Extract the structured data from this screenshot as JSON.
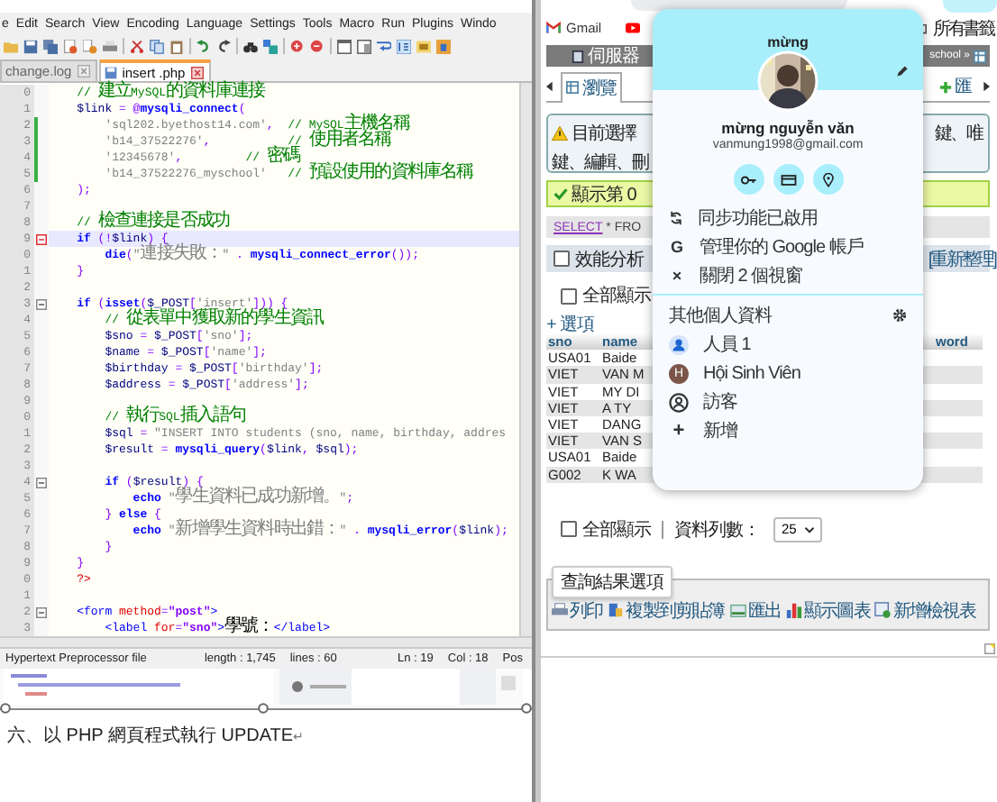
{
  "editor": {
    "menu": [
      "e",
      "Edit",
      "Search",
      "View",
      "Encoding",
      "Language",
      "Settings",
      "Tools",
      "Macro",
      "Run",
      "Plugins",
      "Windo"
    ],
    "tabs": [
      {
        "label": "change.log",
        "selected": false
      },
      {
        "label": "insert .php",
        "selected": true
      }
    ],
    "lines": [
      {
        "num": "0",
        "fold": false,
        "changed": false,
        "current": false,
        "tokens": [
          {
            "kind": "comment",
            "text": "    // "
          },
          {
            "kind": "comment-cjk",
            "text": "建立"
          },
          {
            "kind": "comment",
            "text": "MySQL"
          },
          {
            "kind": "comment-cjk",
            "text": "的資料庫連接"
          }
        ]
      },
      {
        "num": "1",
        "fold": false,
        "changed": false,
        "current": false,
        "tokens": [
          {
            "kind": "var",
            "text": "    $link"
          },
          {
            "kind": "op",
            "text": " = @"
          },
          {
            "kind": "fn",
            "text": "mysqli_connect"
          },
          {
            "kind": "op",
            "text": "("
          }
        ]
      },
      {
        "num": "2",
        "fold": false,
        "changed": true,
        "current": false,
        "tokens": [
          {
            "kind": "string",
            "text": "        'sql202.byethost14.com'"
          },
          {
            "kind": "op",
            "text": ",  "
          },
          {
            "kind": "comment",
            "text": "// MySQL"
          },
          {
            "kind": "comment-cjk",
            "text": "主機名稱"
          }
        ]
      },
      {
        "num": "3",
        "fold": false,
        "changed": true,
        "current": false,
        "tokens": [
          {
            "kind": "string",
            "text": "        'b14_37522276'"
          },
          {
            "kind": "op",
            "text": ",           "
          },
          {
            "kind": "comment",
            "text": "// "
          },
          {
            "kind": "comment-cjk",
            "text": "使用者名稱"
          }
        ]
      },
      {
        "num": "4",
        "fold": false,
        "changed": true,
        "current": false,
        "tokens": [
          {
            "kind": "string",
            "text": "        '12345678'"
          },
          {
            "kind": "op",
            "text": ",         "
          },
          {
            "kind": "comment",
            "text": "// "
          },
          {
            "kind": "comment-cjk",
            "text": "密碼"
          }
        ]
      },
      {
        "num": "5",
        "fold": false,
        "changed": true,
        "current": false,
        "tokens": [
          {
            "kind": "string",
            "text": "        'b14_37522276_myschool'"
          },
          {
            "kind": "comment",
            "text": "   // "
          },
          {
            "kind": "comment-cjk",
            "text": "預設使用的資料庫名稱"
          }
        ]
      },
      {
        "num": "6",
        "fold": false,
        "changed": false,
        "current": false,
        "tokens": [
          {
            "kind": "op",
            "text": "    );"
          }
        ]
      },
      {
        "num": "7",
        "fold": false,
        "changed": false,
        "current": false
      },
      {
        "num": "8",
        "fold": false,
        "changed": false,
        "current": false,
        "tokens": [
          {
            "kind": "comment",
            "text": "    // "
          },
          {
            "kind": "comment-cjk",
            "text": "檢查連接是否成功"
          }
        ]
      },
      {
        "num": "9",
        "fold": true,
        "changed": false,
        "current": true,
        "tokens": [
          {
            "kind": "kw",
            "text": "    if"
          },
          {
            "kind": "op",
            "text": " (!"
          },
          {
            "kind": "var",
            "text": "$link"
          },
          {
            "kind": "op",
            "text": ") {"
          }
        ]
      },
      {
        "num": "0",
        "fold": false,
        "changed": false,
        "current": false,
        "tokens": [
          {
            "kind": "fn",
            "text": "        die"
          },
          {
            "kind": "op",
            "text": "("
          },
          {
            "kind": "string",
            "text": "\""
          },
          {
            "kind": "string-cjk",
            "text": "連接失敗："
          },
          {
            "kind": "string",
            "text": "\""
          },
          {
            "kind": "op",
            "text": " . "
          },
          {
            "kind": "fn",
            "text": "mysqli_connect_error"
          },
          {
            "kind": "op",
            "text": "());"
          }
        ]
      },
      {
        "num": "1",
        "fold": false,
        "changed": false,
        "current": false,
        "tokens": [
          {
            "kind": "op",
            "text": "    }"
          }
        ]
      },
      {
        "num": "2",
        "fold": false,
        "changed": false,
        "current": false
      },
      {
        "num": "3",
        "fold": true,
        "changed": false,
        "current": false,
        "tokens": [
          {
            "kind": "kw",
            "text": "    if"
          },
          {
            "kind": "op",
            "text": " ("
          },
          {
            "kind": "fn",
            "text": "isset"
          },
          {
            "kind": "op",
            "text": "("
          },
          {
            "kind": "var",
            "text": "$_POST"
          },
          {
            "kind": "op",
            "text": "["
          },
          {
            "kind": "string",
            "text": "'insert'"
          },
          {
            "kind": "op",
            "text": "])) {"
          }
        ]
      },
      {
        "num": "4",
        "fold": false,
        "changed": false,
        "current": false,
        "tokens": [
          {
            "kind": "comment",
            "text": "        // "
          },
          {
            "kind": "comment-cjk",
            "text": "從表單中獲取新的學生資訊"
          }
        ]
      },
      {
        "num": "5",
        "fold": false,
        "changed": false,
        "current": false,
        "tokens": [
          {
            "kind": "var",
            "text": "        $sno"
          },
          {
            "kind": "op",
            "text": " = "
          },
          {
            "kind": "var",
            "text": "$_POST"
          },
          {
            "kind": "op",
            "text": "["
          },
          {
            "kind": "string",
            "text": "'sno'"
          },
          {
            "kind": "op",
            "text": "];"
          }
        ]
      },
      {
        "num": "6",
        "fold": false,
        "changed": false,
        "current": false,
        "tokens": [
          {
            "kind": "var",
            "text": "        $name"
          },
          {
            "kind": "op",
            "text": " = "
          },
          {
            "kind": "var",
            "text": "$_POST"
          },
          {
            "kind": "op",
            "text": "["
          },
          {
            "kind": "string",
            "text": "'name'"
          },
          {
            "kind": "op",
            "text": "];"
          }
        ]
      },
      {
        "num": "7",
        "fold": false,
        "changed": false,
        "current": false,
        "tokens": [
          {
            "kind": "var",
            "text": "        $birthday"
          },
          {
            "kind": "op",
            "text": " = "
          },
          {
            "kind": "var",
            "text": "$_POST"
          },
          {
            "kind": "op",
            "text": "["
          },
          {
            "kind": "string",
            "text": "'birthday'"
          },
          {
            "kind": "op",
            "text": "];"
          }
        ]
      },
      {
        "num": "8",
        "fold": false,
        "changed": false,
        "current": false,
        "tokens": [
          {
            "kind": "var",
            "text": "        $address"
          },
          {
            "kind": "op",
            "text": " = "
          },
          {
            "kind": "var",
            "text": "$_POST"
          },
          {
            "kind": "op",
            "text": "["
          },
          {
            "kind": "string",
            "text": "'address'"
          },
          {
            "kind": "op",
            "text": "];"
          }
        ]
      },
      {
        "num": "9",
        "fold": false,
        "changed": false,
        "current": false
      },
      {
        "num": "0",
        "fold": false,
        "changed": false,
        "current": false,
        "tokens": [
          {
            "kind": "comment",
            "text": "        // "
          },
          {
            "kind": "comment-cjk",
            "text": "執行"
          },
          {
            "kind": "comment",
            "text": "SQL"
          },
          {
            "kind": "comment-cjk",
            "text": "插入語句"
          }
        ]
      },
      {
        "num": "1",
        "fold": false,
        "changed": false,
        "current": false,
        "tokens": [
          {
            "kind": "var",
            "text": "        $sql"
          },
          {
            "kind": "op",
            "text": " = "
          },
          {
            "kind": "string",
            "text": "\"INSERT INTO students (sno, name, birthday, addres"
          }
        ]
      },
      {
        "num": "2",
        "fold": false,
        "changed": false,
        "current": false,
        "tokens": [
          {
            "kind": "var",
            "text": "        $result"
          },
          {
            "kind": "op",
            "text": " = "
          },
          {
            "kind": "fn",
            "text": "mysqli_query"
          },
          {
            "kind": "op",
            "text": "("
          },
          {
            "kind": "var",
            "text": "$link"
          },
          {
            "kind": "op",
            "text": ", "
          },
          {
            "kind": "var",
            "text": "$sql"
          },
          {
            "kind": "op",
            "text": ");"
          }
        ]
      },
      {
        "num": "3",
        "fold": false,
        "changed": false,
        "current": false
      },
      {
        "num": "4",
        "fold": true,
        "changed": false,
        "current": false,
        "tokens": [
          {
            "kind": "kw",
            "text": "        if"
          },
          {
            "kind": "op",
            "text": " ("
          },
          {
            "kind": "var",
            "text": "$result"
          },
          {
            "kind": "op",
            "text": ") {"
          }
        ]
      },
      {
        "num": "5",
        "fold": false,
        "changed": false,
        "current": false,
        "tokens": [
          {
            "kind": "fn",
            "text": "            echo"
          },
          {
            "kind": "string",
            "text": " \""
          },
          {
            "kind": "string-cjk",
            "text": "學生資料已成功新增。"
          },
          {
            "kind": "string",
            "text": "\""
          },
          {
            "kind": "op",
            "text": ";"
          }
        ]
      },
      {
        "num": "6",
        "fold": false,
        "changed": false,
        "current": false,
        "tokens": [
          {
            "kind": "op",
            "text": "        } "
          },
          {
            "kind": "kw",
            "text": "else"
          },
          {
            "kind": "op",
            "text": " {"
          }
        ]
      },
      {
        "num": "7",
        "fold": false,
        "changed": false,
        "current": false,
        "tokens": [
          {
            "kind": "fn",
            "text": "            echo"
          },
          {
            "kind": "string",
            "text": " \""
          },
          {
            "kind": "string-cjk",
            "text": "新增學生資料時出錯："
          },
          {
            "kind": "string",
            "text": "\""
          },
          {
            "kind": "op",
            "text": " . "
          },
          {
            "kind": "fn",
            "text": "mysqli_error"
          },
          {
            "kind": "op",
            "text": "("
          },
          {
            "kind": "var",
            "text": "$link"
          },
          {
            "kind": "op",
            "text": ");"
          }
        ]
      },
      {
        "num": "8",
        "fold": false,
        "changed": false,
        "current": false,
        "tokens": [
          {
            "kind": "op",
            "text": "        }"
          }
        ]
      },
      {
        "num": "9",
        "fold": false,
        "changed": false,
        "current": false,
        "tokens": [
          {
            "kind": "op",
            "text": "    }"
          }
        ]
      },
      {
        "num": "0",
        "fold": false,
        "changed": false,
        "current": false,
        "tokens": [
          {
            "kind": "php",
            "text": "    ?>"
          }
        ]
      },
      {
        "num": "1",
        "fold": false,
        "changed": false,
        "current": false
      },
      {
        "num": "2",
        "fold": true,
        "changed": false,
        "current": false,
        "tokens": [
          {
            "kind": "tag",
            "text": "    <form"
          },
          {
            "kind": "attr",
            "text": " method"
          },
          {
            "kind": "op",
            "text": "="
          },
          {
            "kind": "value",
            "text": "\"post\""
          },
          {
            "kind": "tag",
            "text": ">"
          }
        ]
      },
      {
        "num": "3",
        "fold": false,
        "changed": false,
        "current": false,
        "tokens": [
          {
            "kind": "tag",
            "text": "        <label"
          },
          {
            "kind": "attr",
            "text": " for"
          },
          {
            "kind": "op",
            "text": "="
          },
          {
            "kind": "value",
            "text": "\"sno\""
          },
          {
            "kind": "tag",
            "text": ">"
          },
          {
            "kind": "text-cjk",
            "text": "學號："
          },
          {
            "kind": "tag",
            "text": "</label>"
          }
        ]
      }
    ],
    "status": {
      "type": "Hypertext Preprocessor file",
      "length": "length : 1,745",
      "lines": "lines : 60",
      "ln": "Ln : 19",
      "col": "Col : 18",
      "pos": "Pos"
    }
  },
  "document": {
    "heading": "六、以 PHP 網頁程式執行 UPDATE",
    "mark": "↵"
  },
  "browser": {
    "bookmarks": {
      "gmail": "Gmail",
      "all": "所有書籤"
    },
    "breadcrumb": {
      "left": "伺服器",
      "right": "school »"
    },
    "tabs": [
      {
        "label": "瀏覽",
        "selected": true
      },
      {
        "label": "匯",
        "selected": false
      }
    ],
    "notice": {
      "line1_left": "目前選擇",
      "line1_right": "鍵、唯",
      "line2_left": "鍵、編輯、刪"
    },
    "success": "顯示第 0",
    "sql": {
      "keyword": "SELECT",
      "rest": " * FRO"
    },
    "profiling": {
      "label": "效能分析",
      "checked": false,
      "refresh": "[重新整理]"
    },
    "show_all_top": {
      "label": "全部顯示",
      "checked": false
    },
    "options_link": "+ 選項",
    "columns": [
      "sno",
      "name",
      "word"
    ],
    "rows": [
      [
        "USA01",
        "Baide"
      ],
      [
        "VIET",
        "VAN M"
      ],
      [
        "VIET",
        "MY DI"
      ],
      [
        "VIET",
        "A TY"
      ],
      [
        "VIET",
        "DANG"
      ],
      [
        "VIET",
        "VAN S"
      ],
      [
        "USA01",
        "Baide"
      ],
      [
        "G002",
        "K WA"
      ]
    ],
    "show_all_bottom": {
      "label": "全部顯示",
      "checked": false
    },
    "rows_label": "資料列數：",
    "rows_value": "25",
    "results_title": "查詢結果選項",
    "actions": [
      {
        "label": "列印",
        "kind": "print"
      },
      {
        "label": "複製到剪貼簿",
        "kind": "copy"
      },
      {
        "label": "匯出",
        "kind": "export"
      },
      {
        "label": "顯示圖表",
        "kind": "chart"
      },
      {
        "label": "新增檢視表",
        "kind": "view"
      }
    ]
  },
  "profile": {
    "title": "mừng",
    "name": "mừng nguyễn văn",
    "email": "vanmung1998@gmail.com",
    "items": [
      {
        "label": "同步功能已啟用",
        "kind": "sync"
      },
      {
        "label": "管理你的 Google 帳戶",
        "kind": "glyph",
        "icon": "G"
      },
      {
        "label": "關閉 2 個視窗",
        "kind": "glyph",
        "icon": "×"
      }
    ],
    "others_title": "其他個人資料",
    "profiles": [
      {
        "label": "人員 1",
        "kind": "person"
      },
      {
        "label": "Hội Sinh Viên",
        "kind": "letter",
        "initial": "H"
      },
      {
        "label": "訪客",
        "kind": "guest"
      },
      {
        "label": "新增",
        "kind": "glyph",
        "icon": "+"
      }
    ]
  }
}
